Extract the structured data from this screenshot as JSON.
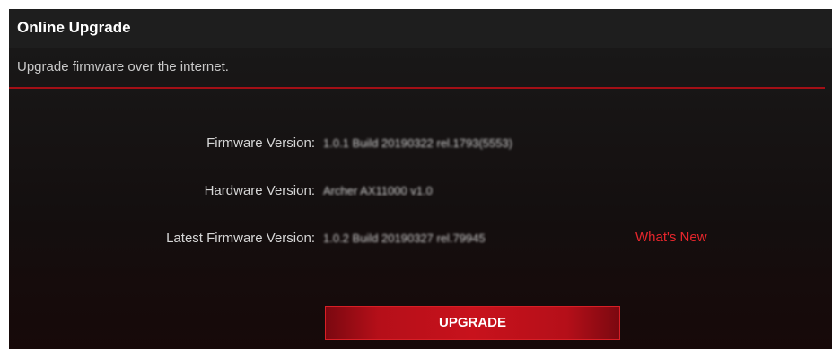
{
  "section": {
    "title": "Online Upgrade",
    "description": "Upgrade firmware over the internet."
  },
  "fields": [
    {
      "label": "Firmware Version:",
      "value": "1.0.1 Build 20190322 rel.1793(5553)"
    },
    {
      "label": "Hardware Version:",
      "value": "Archer AX11000 v1.0"
    },
    {
      "label": "Latest Firmware Version:",
      "value": "1.0.2 Build 20190327 rel.79945"
    }
  ],
  "links": {
    "whats_new": "What's New"
  },
  "actions": {
    "upgrade_label": "UPGRADE"
  },
  "colors": {
    "accent": "#c8121c",
    "link": "#e5262c",
    "panel_bg": "#1a1a1a"
  }
}
